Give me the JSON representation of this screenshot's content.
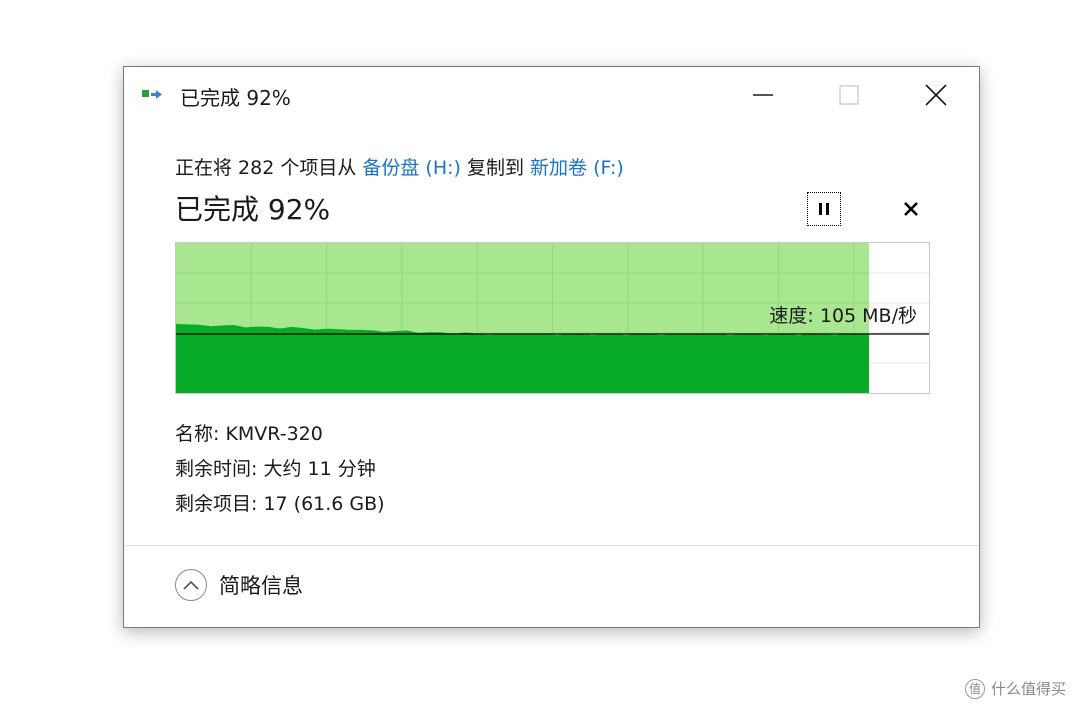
{
  "window": {
    "title": "已完成 92%"
  },
  "copy": {
    "prefix": "正在将 282 个项目从 ",
    "source": "备份盘 (H:)",
    "middle": " 复制到 ",
    "destination": "新加卷 (F:)"
  },
  "progress": {
    "title": "已完成 92%",
    "percent": 92,
    "speed_label": "速度: 105 MB/秒"
  },
  "details": {
    "name": "名称: KMVR-320",
    "time_remaining": "剩余时间: 大约 11 分钟",
    "items_remaining": "剩余项目: 17 (61.6 GB)"
  },
  "footer": {
    "toggle_label": "简略信息"
  },
  "watermark": {
    "text": "什么值得买",
    "logo_glyph": "值"
  },
  "colors": {
    "graph_done": "#a8e690",
    "graph_speed": "#07ab28",
    "link": "#1a73c8",
    "grid": "#8fd978"
  }
}
